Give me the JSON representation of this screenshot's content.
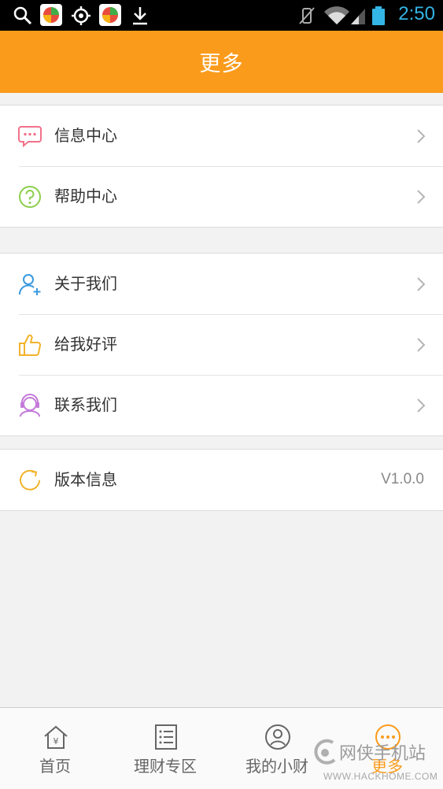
{
  "status_bar": {
    "time": "2:50",
    "icons": [
      "search-icon",
      "app-store-icon",
      "gps-icon",
      "app-store-icon",
      "download-icon",
      "vibrate-off-icon",
      "wifi-icon",
      "signal-icon",
      "battery-icon"
    ]
  },
  "header": {
    "title": "更多"
  },
  "group1": {
    "items": [
      {
        "label": "信息中心",
        "icon": "message-icon"
      },
      {
        "label": "帮助中心",
        "icon": "help-icon"
      }
    ]
  },
  "group2": {
    "items": [
      {
        "label": "关于我们",
        "icon": "add-user-icon"
      },
      {
        "label": "给我好评",
        "icon": "thumbs-up-icon"
      },
      {
        "label": "联系我们",
        "icon": "headset-icon"
      }
    ]
  },
  "group3": {
    "items": [
      {
        "label": "版本信息",
        "icon": "refresh-icon",
        "value": "V1.0.0"
      }
    ]
  },
  "tabbar": {
    "tabs": [
      {
        "label": "首页",
        "icon": "home-icon",
        "active": false
      },
      {
        "label": "理财专区",
        "icon": "list-icon",
        "active": false
      },
      {
        "label": "我的小财",
        "icon": "user-icon",
        "active": false
      },
      {
        "label": "更多",
        "icon": "more-icon",
        "active": true
      }
    ]
  },
  "watermark": {
    "text": "网侠手机站",
    "url": "WWW.HACKHOME.COM"
  },
  "colors": {
    "accent": "#fb9b1b",
    "status_time": "#33b5e5"
  }
}
